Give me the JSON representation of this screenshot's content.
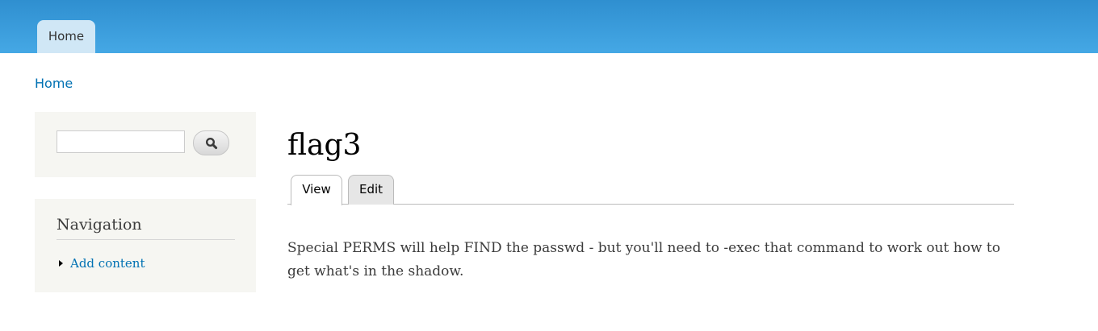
{
  "header": {
    "tabs": [
      {
        "label": "Home"
      }
    ]
  },
  "breadcrumb": {
    "items": [
      {
        "label": "Home"
      }
    ]
  },
  "sidebar": {
    "search": {
      "value": "",
      "placeholder": "",
      "button_icon": "search-icon"
    },
    "navigation": {
      "title": "Navigation",
      "items": [
        {
          "label": "Add content"
        }
      ]
    }
  },
  "main": {
    "title": "flag3",
    "tabs": [
      {
        "label": "View",
        "active": true
      },
      {
        "label": "Edit",
        "active": false
      }
    ],
    "body": "Special PERMS will help FIND the passwd - but you'll need to -exec that command to work out how to get what's in the shadow."
  },
  "colors": {
    "header_gradient_top": "#2f8fd0",
    "header_gradient_bottom": "#45a8e5",
    "link": "#0071b3",
    "sidebar_bg": "#f6f6f2"
  }
}
